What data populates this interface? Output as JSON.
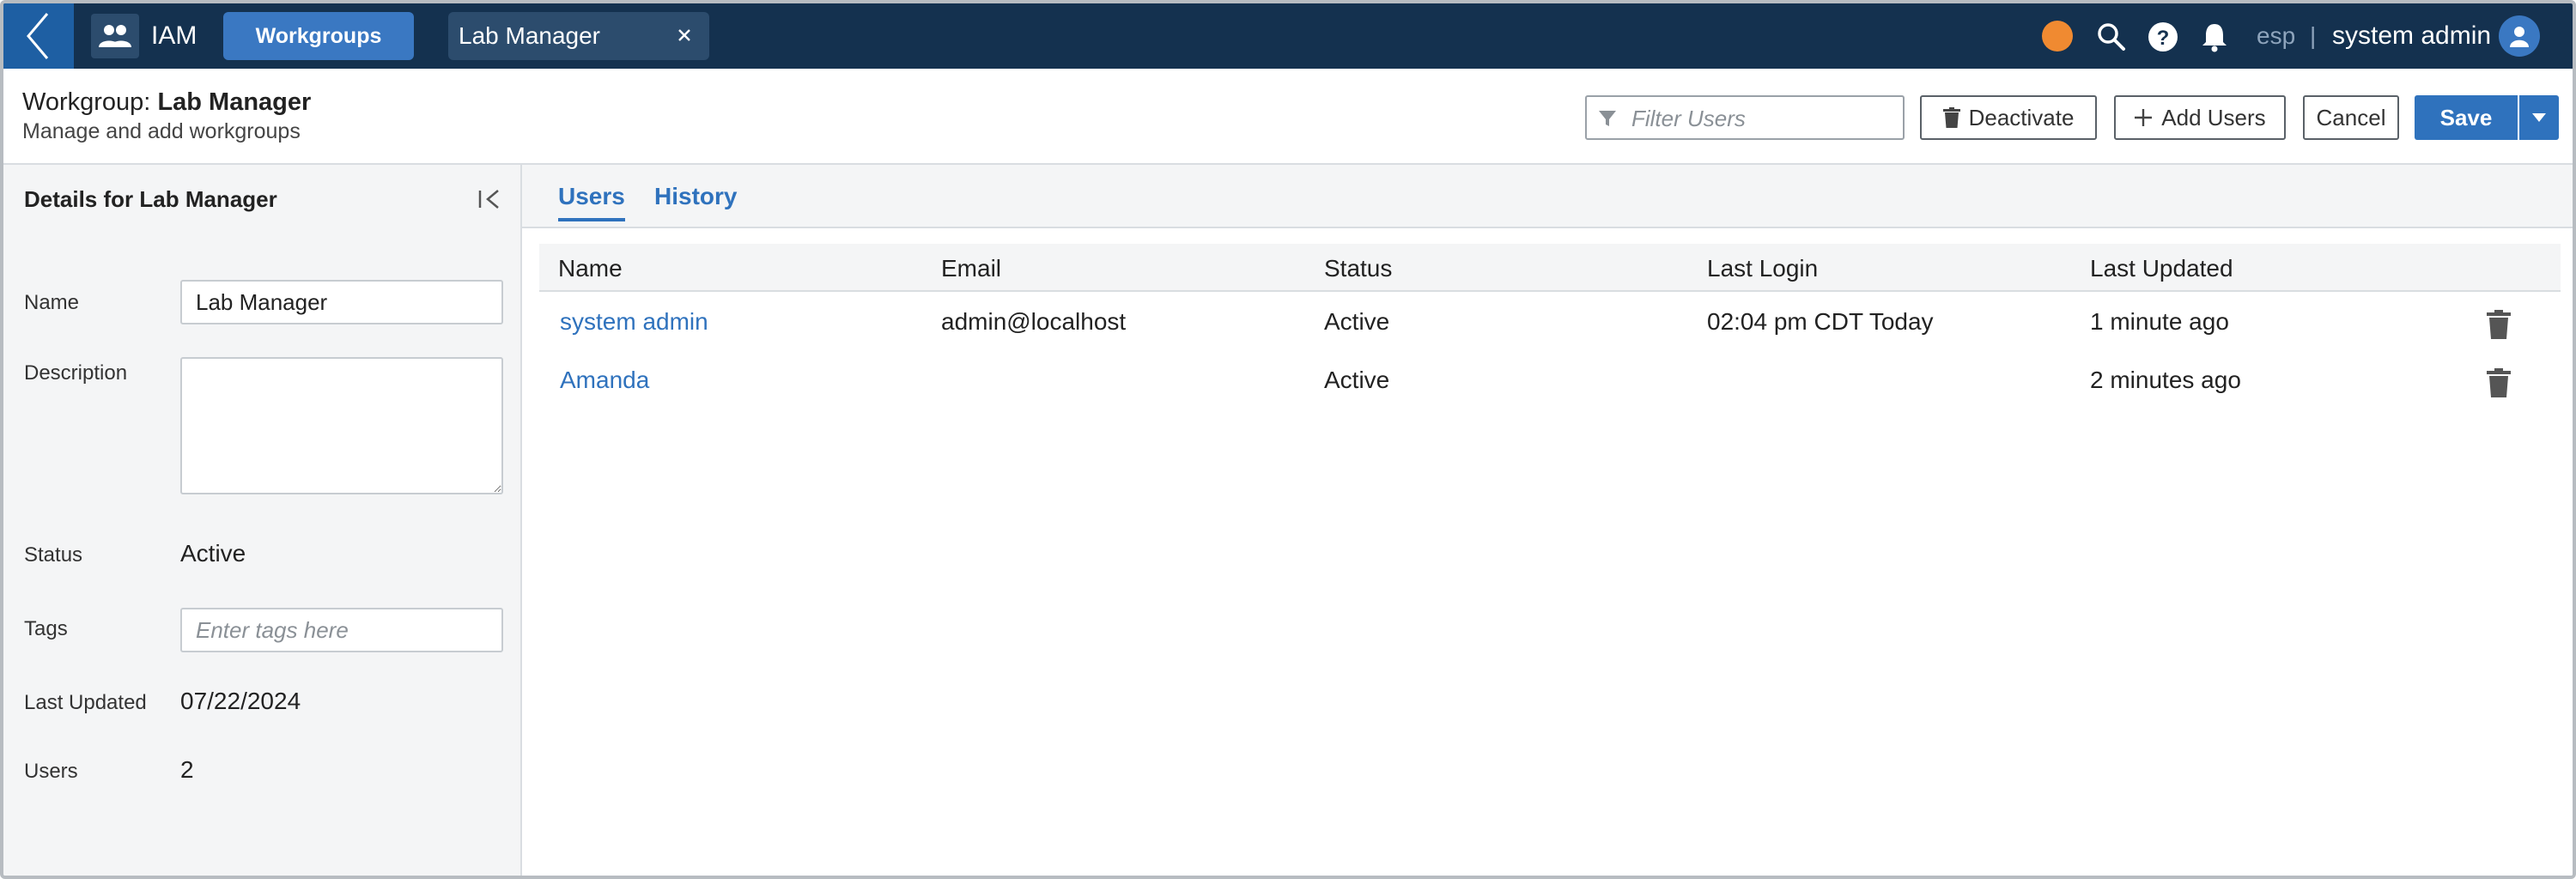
{
  "topbar": {
    "app_name": "IAM",
    "nav_button": "Workgroups",
    "open_tab": "Lab Manager",
    "lang": "esp",
    "lang_sep": "|",
    "user": "system admin",
    "status_color": "#f08a31",
    "icons": [
      "back-chevron-icon",
      "people-icon",
      "close-icon",
      "search-icon",
      "help-icon",
      "bell-icon",
      "user-avatar-icon"
    ]
  },
  "header": {
    "title_prefix": "Workgroup:",
    "title_name": "Lab Manager",
    "subtitle": "Manage and add workgroups",
    "filter_placeholder": "Filter Users",
    "deactivate_label": "Deactivate",
    "add_users_label": "Add Users",
    "cancel_label": "Cancel",
    "save_label": "Save"
  },
  "details": {
    "title": "Details for Lab Manager",
    "name_label": "Name",
    "name_value": "Lab Manager",
    "description_label": "Description",
    "description_value": "",
    "status_label": "Status",
    "status_value": "Active",
    "tags_label": "Tags",
    "tags_placeholder": "Enter tags here",
    "last_updated_label": "Last Updated",
    "last_updated_value": "07/22/2024",
    "users_label": "Users",
    "users_value": "2"
  },
  "tabs": [
    "Users",
    "History"
  ],
  "table": {
    "columns": [
      "Name",
      "Email",
      "Status",
      "Last Login",
      "Last Updated"
    ],
    "rows": [
      [
        "system admin",
        "admin@localhost",
        "Active",
        "02:04 pm CDT Today",
        "1 minute ago"
      ],
      [
        "Amanda",
        "",
        "Active",
        "",
        "2 minutes ago"
      ]
    ]
  },
  "colors": {
    "topbar": "#14314f",
    "accent": "#2f72bd",
    "panel": "#f4f5f6"
  }
}
